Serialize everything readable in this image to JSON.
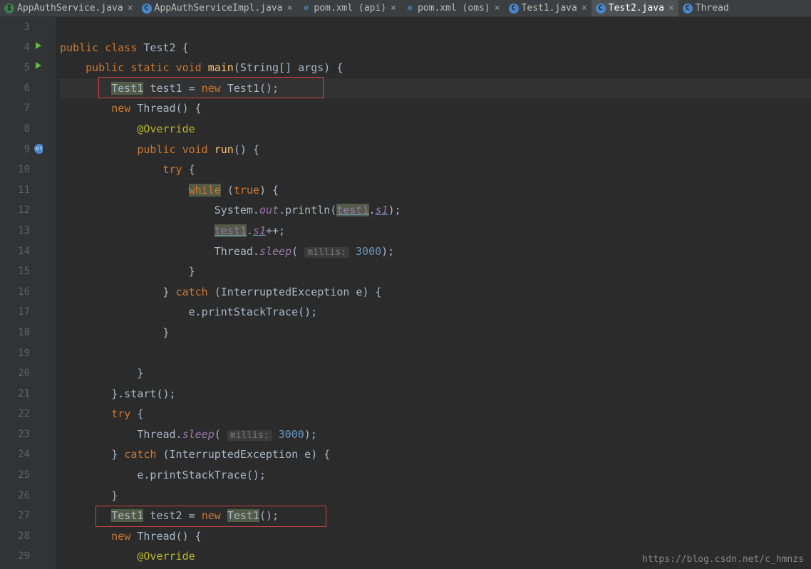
{
  "tabs": [
    {
      "icon": "c-green",
      "label": "AppAuthService.java"
    },
    {
      "icon": "c-blue",
      "label": "AppAuthServiceImpl.java"
    },
    {
      "icon": "m",
      "label": "pom.xml (api)"
    },
    {
      "icon": "m",
      "label": "pom.xml (oms)"
    },
    {
      "icon": "c-blue",
      "label": "Test1.java"
    },
    {
      "icon": "c-blue",
      "label": "Test2.java",
      "active": true
    },
    {
      "icon": "c-blue",
      "label": "Thread"
    }
  ],
  "line_numbers": [
    "3",
    "4",
    "5",
    "6",
    "7",
    "8",
    "9",
    "10",
    "11",
    "12",
    "13",
    "14",
    "15",
    "16",
    "17",
    "18",
    "19",
    "20",
    "21",
    "22",
    "23",
    "24",
    "25",
    "26",
    "27",
    "28",
    "29"
  ],
  "code": {
    "l4": {
      "kw1": "public",
      "kw2": "class",
      "name": "Test2",
      "brace": "{"
    },
    "l5": {
      "kw1": "public",
      "kw2": "static",
      "kw3": "void",
      "method": "main",
      "params": "(String[] args) {"
    },
    "l6": {
      "type1": "Test1",
      "var": "test1",
      "eq": "=",
      "kw": "new",
      "type2": "Test1",
      "paren": "();"
    },
    "l7": {
      "kw": "new",
      "type": "Thread",
      "paren": "() {"
    },
    "l8": {
      "ann": "@Override"
    },
    "l9": {
      "kw1": "public",
      "kw2": "void",
      "method": "run",
      "paren": "() {"
    },
    "l10": {
      "kw": "try",
      "brace": "{"
    },
    "l11": {
      "kw": "while",
      "cond": "(",
      "val": "true",
      "close": ") {"
    },
    "l12": {
      "sys": "System.",
      "out": "out",
      "dot": ".println(",
      "t1": "test1",
      "dot2": ".",
      "s1": "s1",
      "close": ");"
    },
    "l13": {
      "t1": "test1",
      "dot": ".",
      "s1": "s1",
      "inc": "++;"
    },
    "l14": {
      "thread": "Thread.",
      "sleep": "sleep",
      "open": "(",
      "hint": "millis:",
      "val": "3000",
      "close": ");"
    },
    "l15": {
      "brace": "}"
    },
    "l16": {
      "brace1": "}",
      "kw": "catch",
      "open": "(InterruptedException e) {"
    },
    "l17": {
      "call": "e.printStackTrace();"
    },
    "l18": {
      "brace": "}"
    },
    "l20": {
      "brace": "}"
    },
    "l21": {
      "brace": "}.start();"
    },
    "l22": {
      "kw": "try",
      "brace": "{"
    },
    "l23": {
      "thread": "Thread.",
      "sleep": "sleep",
      "open": "(",
      "hint": "millis:",
      "val": "3000",
      "close": ");"
    },
    "l24": {
      "brace1": "}",
      "kw": "catch",
      "open": "(InterruptedException e) {"
    },
    "l25": {
      "call": "e.printStackTrace();"
    },
    "l26": {
      "brace": "}"
    },
    "l27": {
      "type1": "Test1",
      "var": "test2",
      "eq": "=",
      "kw": "new",
      "type2": "Test1",
      "paren": "();"
    },
    "l28": {
      "kw": "new",
      "type": "Thread",
      "paren": "() {"
    },
    "l29": {
      "ann": "@Override"
    }
  },
  "watermark": "https://blog.csdn.net/c_hmnzs"
}
